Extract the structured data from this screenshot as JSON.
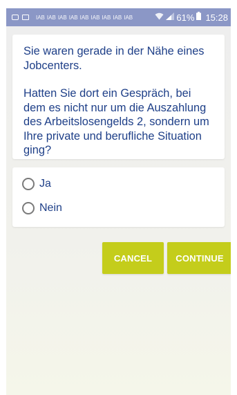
{
  "statusbar": {
    "iab_labels": [
      "IAB",
      "IAB",
      "IAB",
      "IAB",
      "IAB",
      "IAB",
      "IAB",
      "IAB",
      "IAB"
    ],
    "battery_pct": "61%",
    "time": "15:28"
  },
  "question": {
    "intro": "Sie waren gerade in der Nähe eines Jobcenters.",
    "body": "Hatten Sie dort ein Gespräch, bei dem es nicht nur um die Auszahlung des Arbeitslosengelds 2, sondern um Ihre private und berufliche Situation ging?"
  },
  "options": [
    {
      "label": "Ja",
      "selected": false
    },
    {
      "label": "Nein",
      "selected": false
    }
  ],
  "buttons": {
    "cancel": "CANCEL",
    "continue": "CONTINUE"
  },
  "colors": {
    "statusbar": "#8b97c6",
    "question_text": "#1e3f88",
    "button": "#c4cd1b"
  }
}
